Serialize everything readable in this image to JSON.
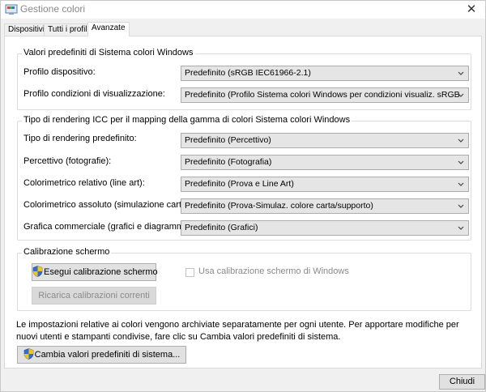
{
  "window": {
    "title": "Gestione colori",
    "close_glyph": "✕"
  },
  "tabs": [
    {
      "label": "Dispositivi",
      "active": false
    },
    {
      "label": "Tutti i profili",
      "active": false
    },
    {
      "label": "Avanzate",
      "active": true
    }
  ],
  "defaults_group": {
    "legend": "Valori predefiniti di Sistema colori Windows",
    "rows": [
      {
        "label": "Profilo dispositivo:",
        "value": "Predefinito (sRGB IEC61966-2.1)"
      },
      {
        "label": "Profilo condizioni di visualizzazione:",
        "value": "Predefinito (Profilo Sistema colori Windows per condizioni visualiz. sRGB)"
      }
    ]
  },
  "rendering_group": {
    "legend": "Tipo di rendering ICC per il mapping della gamma di colori Sistema colori Windows",
    "rows": [
      {
        "label": "Tipo di rendering predefinito:",
        "value": "Predefinito (Percettivo)"
      },
      {
        "label": "Percettivo (fotografie):",
        "value": "Predefinito (Fotografia)"
      },
      {
        "label": "Colorimetrico relativo (line art):",
        "value": "Predefinito (Prova e Line Art)"
      },
      {
        "label": "Colorimetrico assoluto (simulazione carta):",
        "value": "Predefinito (Prova-Simulaz. colore carta/supporto)"
      },
      {
        "label": "Grafica commerciale (grafici e diagrammi):",
        "value": "Predefinito (Grafici)"
      }
    ]
  },
  "calibration_group": {
    "legend": "Calibrazione schermo",
    "calibrate_button": "Esegui calibrazione schermo",
    "reload_button": "Ricarica calibrazioni correnti",
    "use_windows_calibration": "Usa calibrazione schermo di Windows",
    "use_windows_calibration_checked": false
  },
  "info_text": "Le impostazioni relative ai colori vengono archiviate separatamente per ogni utente. Per apportare modifiche per nuovi utenti e stampanti condivise, fare clic su Cambia valori predefiniti di sistema.",
  "change_defaults_button": "Cambia valori predefiniti di sistema...",
  "close_button": "Chiudi",
  "icons": {
    "app": "color-management-icon",
    "uac_shield": "uac-shield-icon",
    "dropdown": "chevron-down-icon"
  },
  "colors": {
    "shield_blue": "#2f6fd0",
    "shield_yellow": "#f3c41a"
  }
}
